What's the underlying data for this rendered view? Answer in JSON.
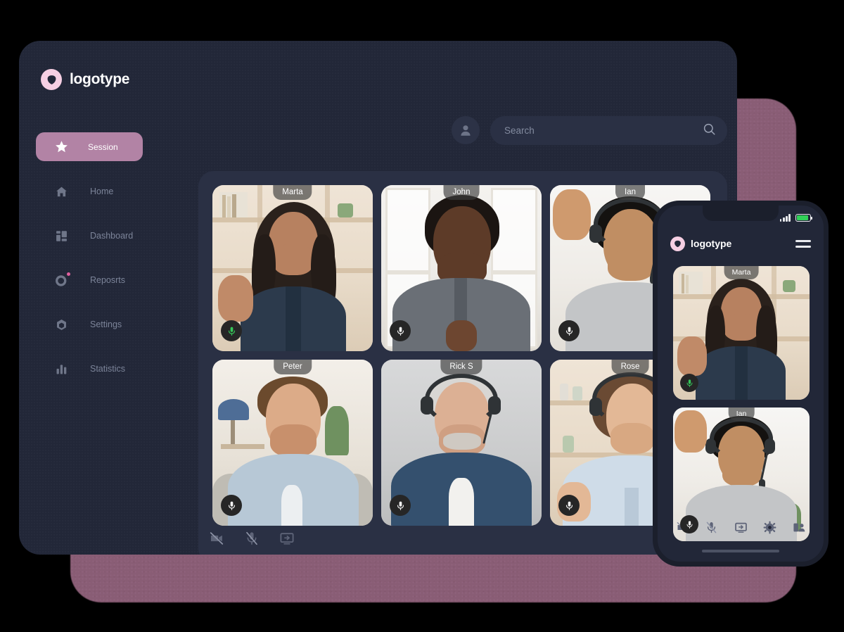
{
  "brand": {
    "name": "logotype",
    "logo_icon": "shield-triangle-icon",
    "logo_color": "#f6cfe3"
  },
  "header": {
    "avatar_icon": "user-avatar-icon",
    "search": {
      "placeholder": "Search",
      "value": "",
      "icon": "search-icon"
    }
  },
  "sidebar": {
    "items": [
      {
        "label": "Session",
        "icon": "star-icon",
        "active": true,
        "badge": false
      },
      {
        "label": "Home",
        "icon": "home-icon",
        "active": false,
        "badge": false
      },
      {
        "label": "Dashboard",
        "icon": "dashboard-icon",
        "active": false,
        "badge": false
      },
      {
        "label": "Reposrts",
        "icon": "donut-icon",
        "active": false,
        "badge": true
      },
      {
        "label": "Settings",
        "icon": "hexagon-icon",
        "active": false,
        "badge": false
      },
      {
        "label": "Statistics",
        "icon": "bar-chart-icon",
        "active": false,
        "badge": false
      }
    ],
    "active_bg_color": "#b283a5",
    "badge_color": "#e0609f"
  },
  "call": {
    "participants": [
      {
        "name": "Marta",
        "mic": "on",
        "mic_color": "#35c759"
      },
      {
        "name": "John",
        "mic": "off",
        "mic_color": "#ffffff"
      },
      {
        "name": "Ian",
        "mic": "off",
        "mic_color": "#ffffff"
      },
      {
        "name": "Peter",
        "mic": "off",
        "mic_color": "#ffffff"
      },
      {
        "name": "Rick S",
        "mic": "off",
        "mic_color": "#ffffff"
      },
      {
        "name": "Rose",
        "mic": "off",
        "mic_color": "#ffffff"
      }
    ],
    "controls": [
      {
        "label": "Camera off",
        "icon": "video-off-icon"
      },
      {
        "label": "Microphone off",
        "icon": "mic-off-icon"
      },
      {
        "label": "Share screen",
        "icon": "screen-share-icon"
      }
    ]
  },
  "phone": {
    "status": {
      "signal_icon": "signal-bars-icon",
      "battery_icon": "battery-icon",
      "battery_color": "#31d158"
    },
    "menu_icon": "hamburger-menu-icon",
    "participants": [
      {
        "name": "Marta",
        "mic": "on",
        "mic_color": "#35c759"
      },
      {
        "name": "Ian",
        "mic": "off",
        "mic_color": "#ffffff"
      }
    ],
    "controls": [
      {
        "label": "Camera off",
        "icon": "video-off-icon"
      },
      {
        "label": "Microphone off",
        "icon": "mic-off-icon"
      },
      {
        "label": "Share screen",
        "icon": "screen-share-icon"
      },
      {
        "label": "Settings",
        "icon": "gear-icon"
      },
      {
        "label": "Participants",
        "icon": "add-person-icon"
      }
    ]
  },
  "theme": {
    "page_bg": "#000000",
    "device_bg": "#222738",
    "panel_bg": "#2a3044",
    "accent": "#b283a5",
    "blob_color": "#95657f",
    "muted_text": "#7c8499"
  }
}
